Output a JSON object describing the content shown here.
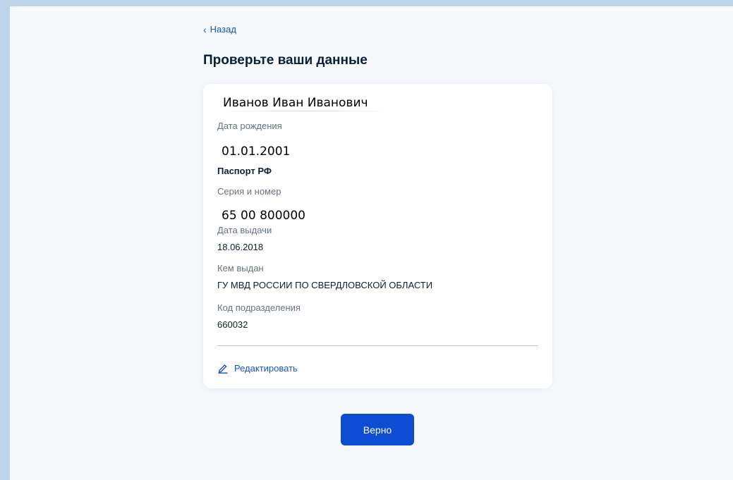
{
  "nav": {
    "back_label": "Назад"
  },
  "page": {
    "title": "Проверьте ваши данные"
  },
  "person": {
    "full_name": "Иванов Иван Иванович",
    "birth_date_label": "Дата рождения",
    "birth_date": "01.01.2001"
  },
  "passport": {
    "section_title": "Паспорт РФ",
    "series_number_label": "Серия и номер",
    "series_number": "65 00 800000",
    "issue_date_label": "Дата выдачи",
    "issue_date": "18.06.2018",
    "issued_by_label": "Кем выдан",
    "issued_by": "ГУ МВД РОССИИ ПО СВЕРДЛОВСКОЙ ОБЛАСТИ",
    "division_code_label": "Код подразделения",
    "division_code": "660032"
  },
  "actions": {
    "edit_label": "Редактировать",
    "confirm_label": "Верно"
  },
  "icons": {
    "back": "chevron-left-icon",
    "edit": "pencil-icon"
  },
  "colors": {
    "accent": "#0d4cd3",
    "link": "#1a4fc9",
    "frame": "#bcd3ea",
    "background": "#f6f9fc"
  }
}
